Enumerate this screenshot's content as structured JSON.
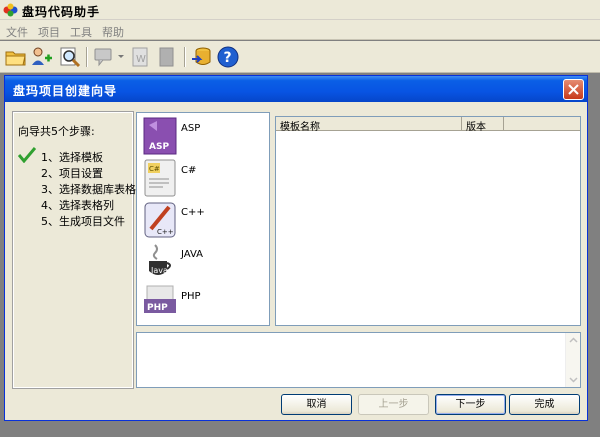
{
  "app": {
    "title": "盘玛代码助手"
  },
  "menu": {
    "items": [
      "文件",
      "项目",
      "工具",
      "帮助"
    ]
  },
  "toolbar": {
    "icons": [
      "folder-open-icon",
      "add-user-icon",
      "search-icon",
      "comment-icon",
      "word-doc-icon",
      "copy-icon",
      "database-export-icon",
      "help-icon"
    ]
  },
  "dialog": {
    "title": "盘玛项目创建向导",
    "steps_header": "向导共5个步骤:",
    "steps": [
      "1、选择模板",
      "2、项目设置",
      "3、选择数据库表格",
      "4、选择表格列",
      "5、生成项目文件"
    ],
    "templates": [
      {
        "label": "ASP",
        "icon": "asp-icon"
      },
      {
        "label": "C#",
        "icon": "csharp-icon"
      },
      {
        "label": "C++",
        "icon": "cpp-icon"
      },
      {
        "label": "JAVA",
        "icon": "java-icon"
      },
      {
        "label": "PHP",
        "icon": "php-icon"
      }
    ],
    "table": {
      "columns": [
        "模板名称",
        "版本"
      ],
      "rows": []
    },
    "description": "",
    "buttons": {
      "cancel": "取消",
      "prev": "上一步",
      "next": "下一步",
      "finish": "完成"
    }
  },
  "colors": {
    "titlebar": "#0854e3",
    "close": "#c83a1a",
    "window": "#ece9d8",
    "desktop": "#808080"
  }
}
